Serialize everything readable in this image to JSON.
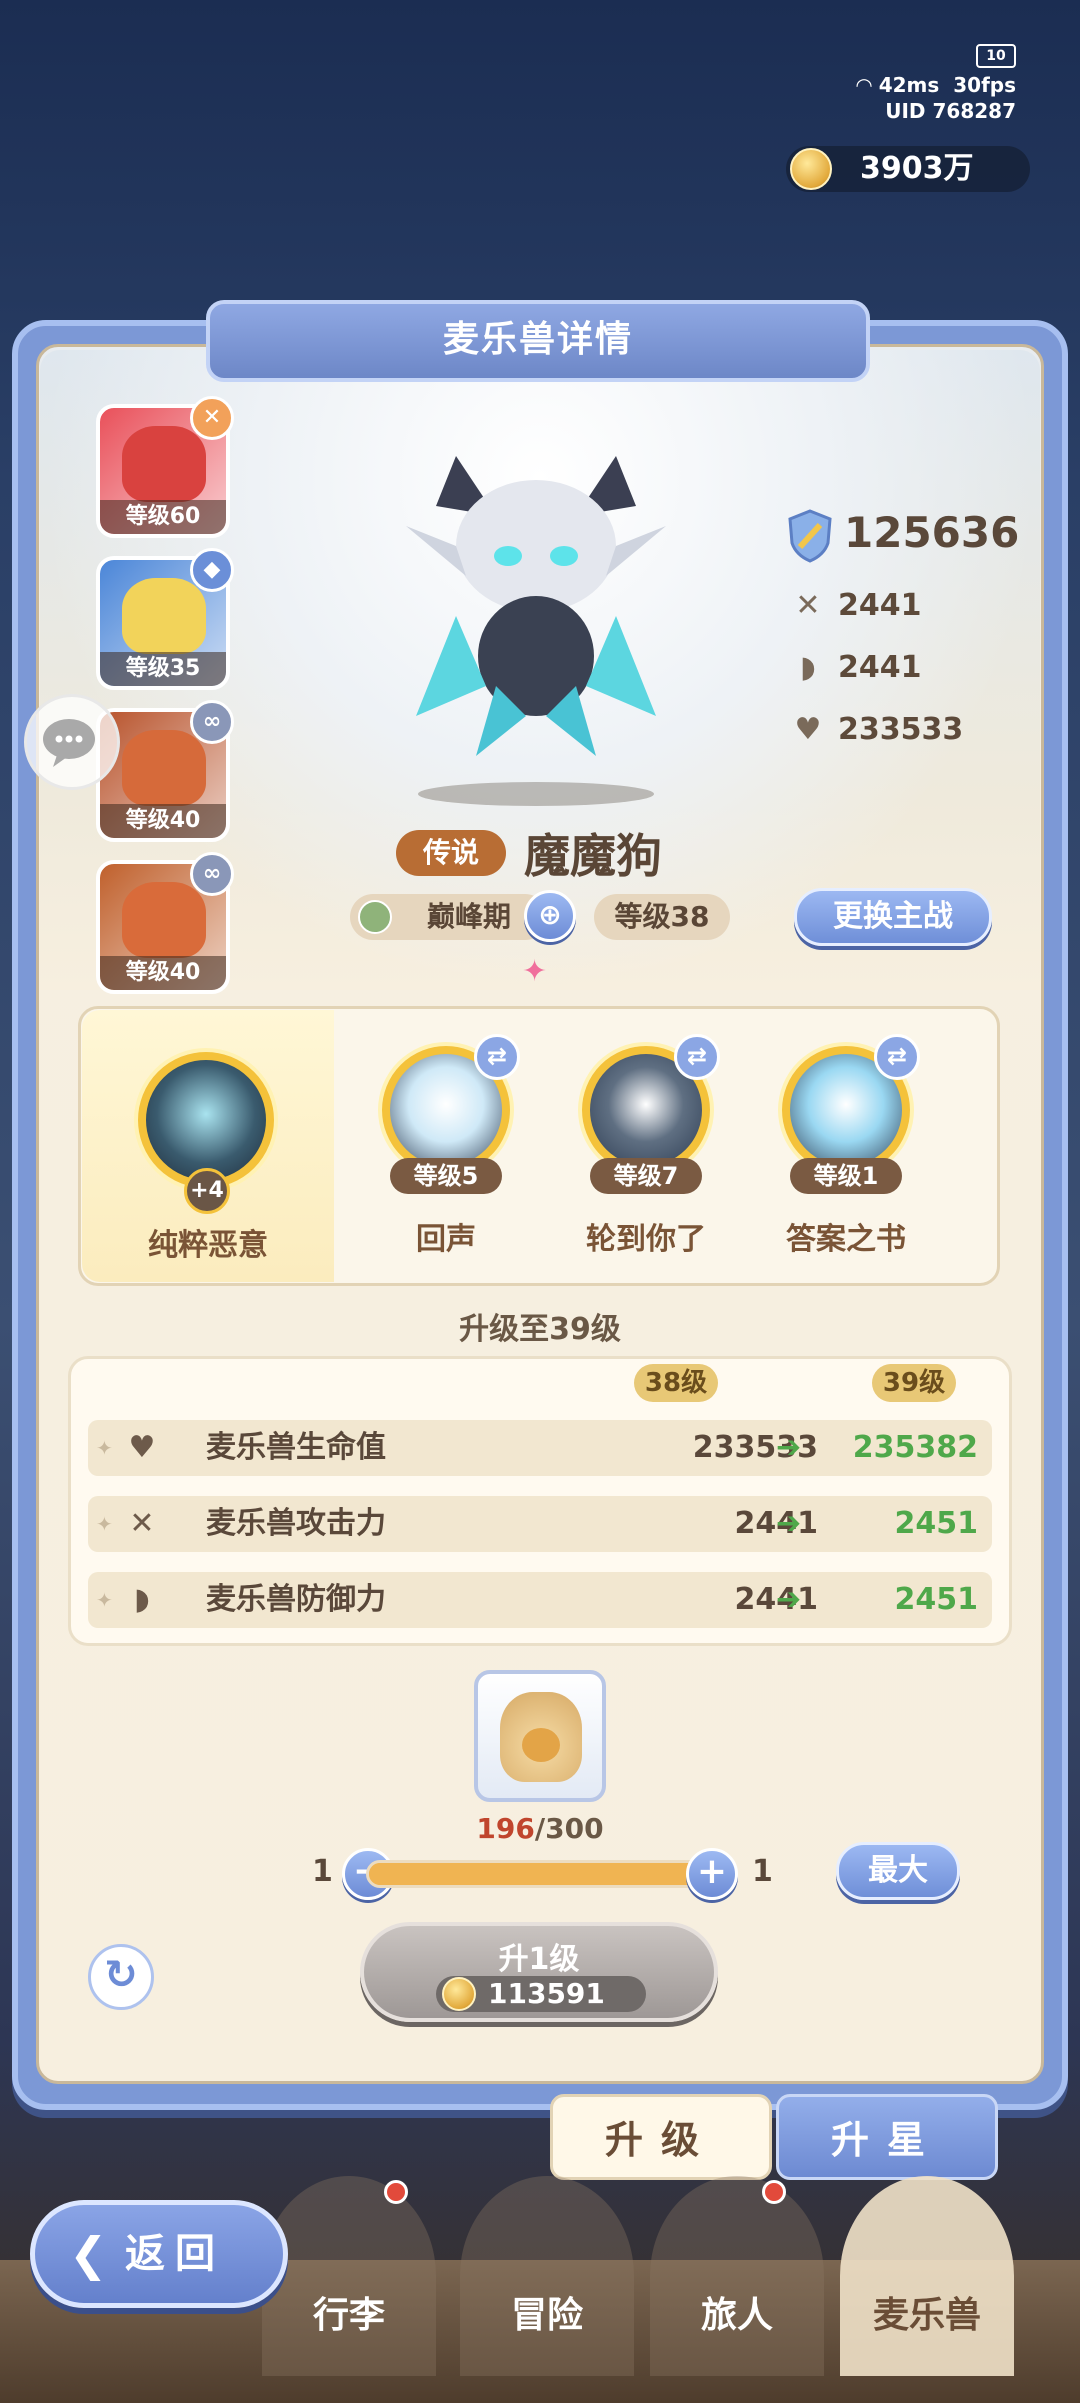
{
  "hud": {
    "battery": "10",
    "ping": "42ms",
    "fps": "30fps",
    "uid_label": "UID",
    "uid": "768287",
    "coins": "3903万"
  },
  "panel": {
    "title": "麦乐兽详情"
  },
  "team": [
    {
      "level": "等级60",
      "badge": "✕",
      "badge_color": "#f2a15a",
      "bg": "#e9505a",
      "mon": "#d9423f"
    },
    {
      "level": "等级35",
      "badge": "◆",
      "badge_color": "#6b8fd8",
      "bg": "#4b86d8",
      "mon": "#f2d35a"
    },
    {
      "level": "等级40",
      "badge": "∞",
      "badge_color": "#8a97b8",
      "bg": "#b8532c",
      "mon": "#d66a3a"
    },
    {
      "level": "等级40",
      "badge": "∞",
      "badge_color": "#8a97b8",
      "bg": "#c0602c",
      "mon": "#d96b3a"
    }
  ],
  "stats": {
    "power": "125636",
    "attack": "2441",
    "defense": "2441",
    "hp": "233533"
  },
  "pet": {
    "rarity": "传说",
    "name": "魔魔狗",
    "stage": "巅峰期",
    "level": "等级38",
    "change_main_label": "更换主战"
  },
  "skills": {
    "main": {
      "name": "纯粹恶意",
      "plus": "+4"
    },
    "list": [
      {
        "name": "回声",
        "level": "等级5",
        "orb": "#cfe9f7"
      },
      {
        "name": "轮到你了",
        "level": "等级7",
        "orb": "#5f6f82"
      },
      {
        "name": "答案之书",
        "level": "等级1",
        "orb": "#9ad8f2"
      }
    ]
  },
  "upgrade": {
    "title": "升级至39级",
    "from_level": "38级",
    "to_level": "39级",
    "rows": [
      {
        "icon": "heart-icon",
        "label": "麦乐兽生命值",
        "current": "233533",
        "next": "235382"
      },
      {
        "icon": "swords-icon",
        "label": "麦乐兽攻击力",
        "current": "2441",
        "next": "2451"
      },
      {
        "icon": "shield-icon",
        "label": "麦乐兽防御力",
        "current": "2441",
        "next": "2451"
      }
    ]
  },
  "material": {
    "have": "196",
    "need": "/300",
    "slider_min": "1",
    "slider_max": "1",
    "slider_fraction": 1.0,
    "max_label": "最大",
    "minus": "−",
    "plus": "+"
  },
  "level_up": {
    "label": "升1级",
    "cost": "113591"
  },
  "tabs": {
    "upgrade": "升级",
    "star_up": "升星"
  },
  "nav": {
    "back": "返回",
    "items": [
      "行李",
      "冒险",
      "旅人",
      "麦乐兽"
    ]
  },
  "colors": {
    "panel_blue": "#7c98d6",
    "accent_green": "#4fa84a",
    "rarity_orange": "#b86d34"
  }
}
